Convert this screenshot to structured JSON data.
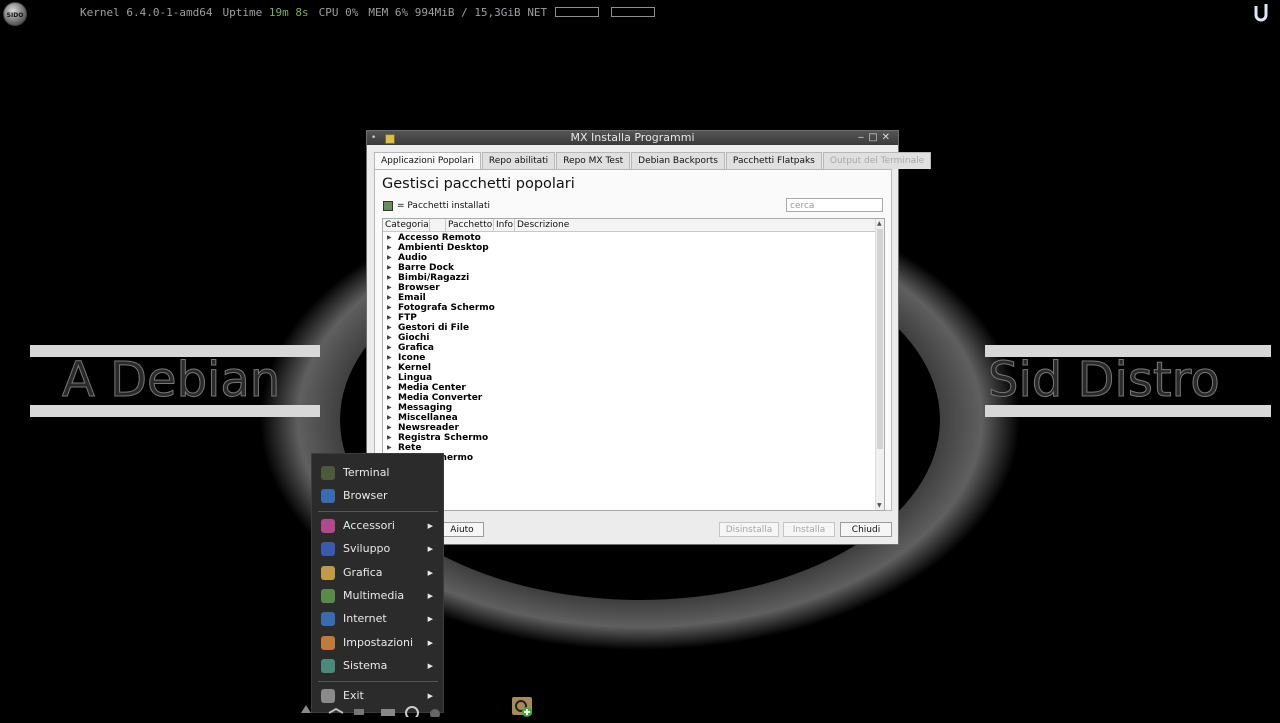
{
  "conky": {
    "kernel_label": "Kernel",
    "kernel_value": "6.4.0-1-amd64",
    "uptime_label": "Uptime",
    "uptime_value": "19m 8s",
    "cpu_label": "CPU",
    "cpu_value": "0%",
    "mem_label": "MEM",
    "mem_value": "6% 994MiB / 15,3GiB",
    "net_label": "NET"
  },
  "desktop": {
    "logo_text": "SIDO",
    "left_text": "A Debian",
    "right_text": "Sid Distro"
  },
  "window": {
    "title": "MX Installa Programmi",
    "tabs": [
      {
        "label": "Applicazioni Popolari",
        "active": true
      },
      {
        "label": "Repo abilitati"
      },
      {
        "label": "Repo MX Test"
      },
      {
        "label": "Debian Backports"
      },
      {
        "label": "Pacchetti Flatpaks"
      },
      {
        "label": "Output del Terminale",
        "disabled": true
      }
    ],
    "heading": "Gestisci pacchetti popolari",
    "legend": "= Pacchetti installati",
    "search_placeholder": "cerca",
    "columns": [
      "Categoria",
      "",
      "Pacchetto",
      "Info",
      "Descrizione"
    ],
    "categories": [
      "Accesso Remoto",
      "Ambienti Desktop",
      "Audio",
      "Barre Dock",
      "Bimbi/Ragazzi",
      "Browser",
      "Email",
      "Fotografa Schermo",
      "FTP",
      "Gestori di File",
      "Giochi",
      "Grafica",
      "Icone",
      "Kernel",
      "Lingua",
      "Media Center",
      "Media Converter",
      "Messaging",
      "Miscellanea",
      "Newsreader",
      "Registra Schermo",
      "Rete",
      "Salva Schermo"
    ],
    "buttons": {
      "help": "Aiuto",
      "uninstall": "Disinstalla",
      "install": "Installa",
      "close": "Chiudi"
    }
  },
  "startmenu": {
    "items": [
      {
        "label": "Terminal",
        "icon": "terminal-icon",
        "color": "#4a5a3a"
      },
      {
        "label": "Browser",
        "icon": "browser-icon",
        "color": "#3a6ab0"
      },
      {
        "label": "Accessori",
        "icon": "accessories-icon",
        "color": "#b04a8a",
        "submenu": true
      },
      {
        "label": "Sviluppo",
        "icon": "development-icon",
        "color": "#3a5ab0",
        "submenu": true
      },
      {
        "label": "Grafica",
        "icon": "graphics-icon",
        "color": "#c09a4a",
        "submenu": true
      },
      {
        "label": "Multimedia",
        "icon": "multimedia-icon",
        "color": "#5a8a4a",
        "submenu": true
      },
      {
        "label": "Internet",
        "icon": "internet-icon",
        "color": "#3a6ab0",
        "submenu": true
      },
      {
        "label": "Impostazioni",
        "icon": "settings-icon",
        "color": "#c07a3a",
        "submenu": true
      },
      {
        "label": "Sistema",
        "icon": "system-icon",
        "color": "#4a8a7a",
        "submenu": true
      },
      {
        "label": "Exit",
        "icon": "exit-icon",
        "color": "#8a8a8a",
        "submenu": true
      }
    ]
  }
}
